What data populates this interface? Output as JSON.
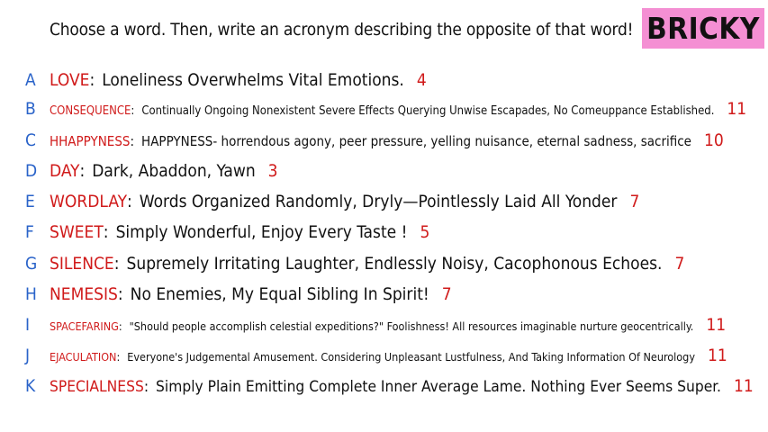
{
  "prompt": "Choose a word. Then, write an acronym describing the opposite of that word!",
  "brand": "BRICKY",
  "entries": [
    {
      "letter": "A",
      "word": "LOVE",
      "acronym": "Loneliness Overwhelms Vital Emotions.",
      "count": "4"
    },
    {
      "letter": "B",
      "word": "CONSEQUENCE",
      "acronym": "Continually Ongoing Nonexistent Severe Effects Querying Unwise Escapades, No Comeuppance Established.",
      "count": "11"
    },
    {
      "letter": "C",
      "word": "HHAPPYNESS",
      "acronym": "HAPPYNESS- horrendous agony, peer pressure, yelling nuisance, eternal sadness, sacrifice",
      "count": "10"
    },
    {
      "letter": "D",
      "word": "DAY",
      "acronym": "Dark, Abaddon, Yawn",
      "count": "3"
    },
    {
      "letter": "E",
      "word": "WORDLAY",
      "acronym": "Words Organized Randomly, Dryly—Pointlessly Laid All Yonder",
      "count": "7"
    },
    {
      "letter": "F",
      "word": "SWEET",
      "acronym": "Simply Wonderful, Enjoy Every Taste !",
      "count": "5"
    },
    {
      "letter": "G",
      "word": "SILENCE",
      "acronym": "Supremely Irritating Laughter, Endlessly Noisy, Cacophonous Echoes.",
      "count": "7"
    },
    {
      "letter": "H",
      "word": "NEMESIS",
      "acronym": "No Enemies, My Equal Sibling In Spirit!",
      "count": "7"
    },
    {
      "letter": "I",
      "word": "SPACEFARING",
      "acronym": "\"Should people accomplish celestial expeditions?\" Foolishness! All resources imaginable nurture geocentrically.",
      "count": "11"
    },
    {
      "letter": "J",
      "word": "EJACULATION",
      "acronym": "Everyone's Judgemental Amusement. Considering Unpleasant Lustfulness, And Taking Information Of Neurology",
      "count": "11"
    },
    {
      "letter": "K",
      "word": "SPECIALNESS",
      "acronym": "Simply Plain Emitting Complete Inner Average Lame. Nothing Ever Seems Super.",
      "count": "11"
    }
  ]
}
